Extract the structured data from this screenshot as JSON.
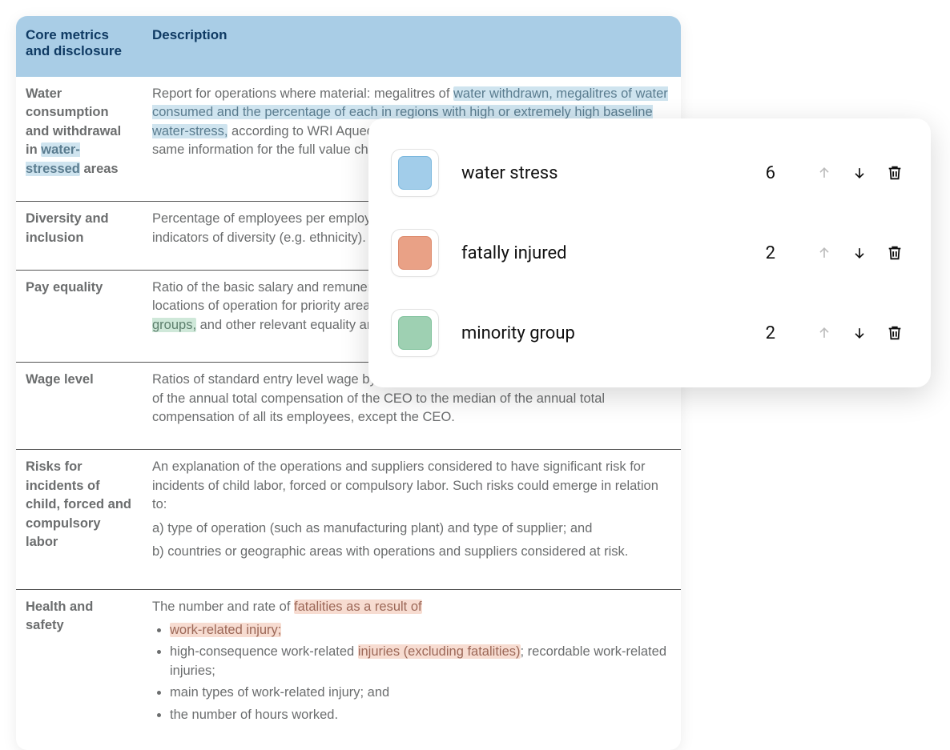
{
  "table": {
    "headers": {
      "c1": "Core metrics and disclosure",
      "c2": "Description"
    },
    "rows": [
      {
        "name_parts": [
          "Water consumption and withdrawal in ",
          "water- stressed",
          " areas"
        ],
        "desc_parts": [
          "Report for operations where material: megalitres of ",
          "water withdrawn, megalitres of water consumed and the percentage of each in regions with high or extremely high baseline water-stress,",
          " according to WRI Aqueduct water risk atlas tool. Estimate and report the same information for the full value chain (upstream and downstream) where appropriate."
        ]
      },
      {
        "name": "Diversity and inclusion",
        "desc": "Percentage of employees per employee category, by age group, gender and other indicators of diversity (e.g. ethnicity)."
      },
      {
        "name": "Pay equality",
        "desc_parts": [
          "Ratio of the basic salary and remuneration for each employee category by significant locations of operation for priority areas of equality: women to men, ",
          "minor to major ethnic groups,",
          " and other relevant equality areas."
        ]
      },
      {
        "name": "Wage level",
        "desc": "Ratios of standard entry level wage by gender compared to local minimum wage. Ratio of the annual total compensation of the CEO to the median of the annual total compensation of all its employees, except the CEO."
      },
      {
        "name": "Risks for incidents of child, forced and compulsory labor",
        "desc_lines": [
          "An explanation of the operations and suppliers considered to have significant risk for incidents of child labor, forced or compulsory labor. Such risks could emerge in relation to:",
          "a) type of operation (such as manufacturing plant) and type of supplier; and",
          "b) countries or geographic areas with operations and suppliers considered at risk."
        ]
      },
      {
        "name": "Health and safety",
        "desc_intro_parts": [
          "The number and rate of ",
          "fatalities as a result of"
        ],
        "desc_bullets": [
          {
            "parts": [
              "",
              "work-related injury;",
              ""
            ]
          },
          {
            "parts": [
              "high-consequence work-related ",
              "injuries (excluding fatalities)",
              "; recordable work-related injuries;"
            ]
          },
          {
            "text": "main types of work-related injury; and"
          },
          {
            "text": "the number of hours worked."
          }
        ]
      }
    ]
  },
  "panel": {
    "items": [
      {
        "color": "#a2cdea",
        "border": "#7bb8de",
        "label": "water stress",
        "count": "6"
      },
      {
        "color": "#e9a186",
        "border": "#dd8a6c",
        "label": "fatally injured",
        "count": "2"
      },
      {
        "color": "#9ed0b2",
        "border": "#7fc19b",
        "label": "minority group",
        "count": "2"
      }
    ]
  }
}
